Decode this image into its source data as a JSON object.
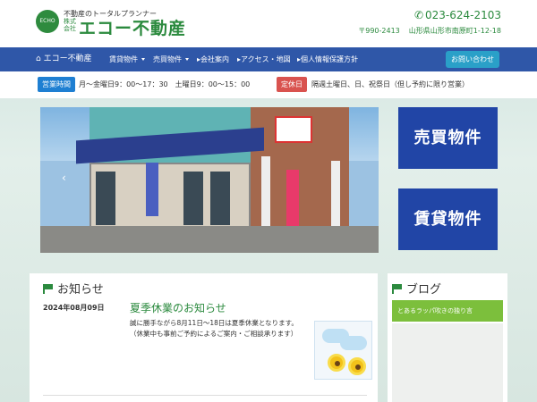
{
  "header": {
    "logo_mark": "ECHO",
    "tagline": "不動産のトータルプランナー",
    "kabushiki": "株式会社",
    "company_name": "エコー不動産",
    "phone": "023-624-2103",
    "postal": "〒990-2413",
    "address": "山形県山形市南原町1-12-18"
  },
  "nav": {
    "home": "エコー不動産",
    "items": [
      "賃貸物件",
      "売買物件",
      "会社案内",
      "アクセス・地図",
      "個人情報保護方針"
    ],
    "contact": "お問い合わせ"
  },
  "hours": {
    "open_badge": "営業時間",
    "open_text": "月～金曜日9：00～17：30　土曜日9：00～15：00",
    "closed_badge": "定休日",
    "closed_text": "隔週土曜日、日、祝祭日（但し予約に限り営業）"
  },
  "buttons": {
    "sale": "売買物件",
    "rent": "賃貸物件"
  },
  "news": {
    "title": "お知らせ",
    "date": "2024年08月09日",
    "headline": "夏季休業のお知らせ",
    "body_line1": "誠に勝手ながら8月11日～18日は夏季休業となります。",
    "body_line2": "（休業中も事前ご予約によるご案内・ご相談承ります）"
  },
  "blog": {
    "title": "ブログ",
    "item": "とあるラッパ吹きの独り言"
  },
  "colors": {
    "brand_green": "#2b8a3e",
    "nav_blue": "#2f57a8",
    "button_blue": "#2145a6"
  }
}
